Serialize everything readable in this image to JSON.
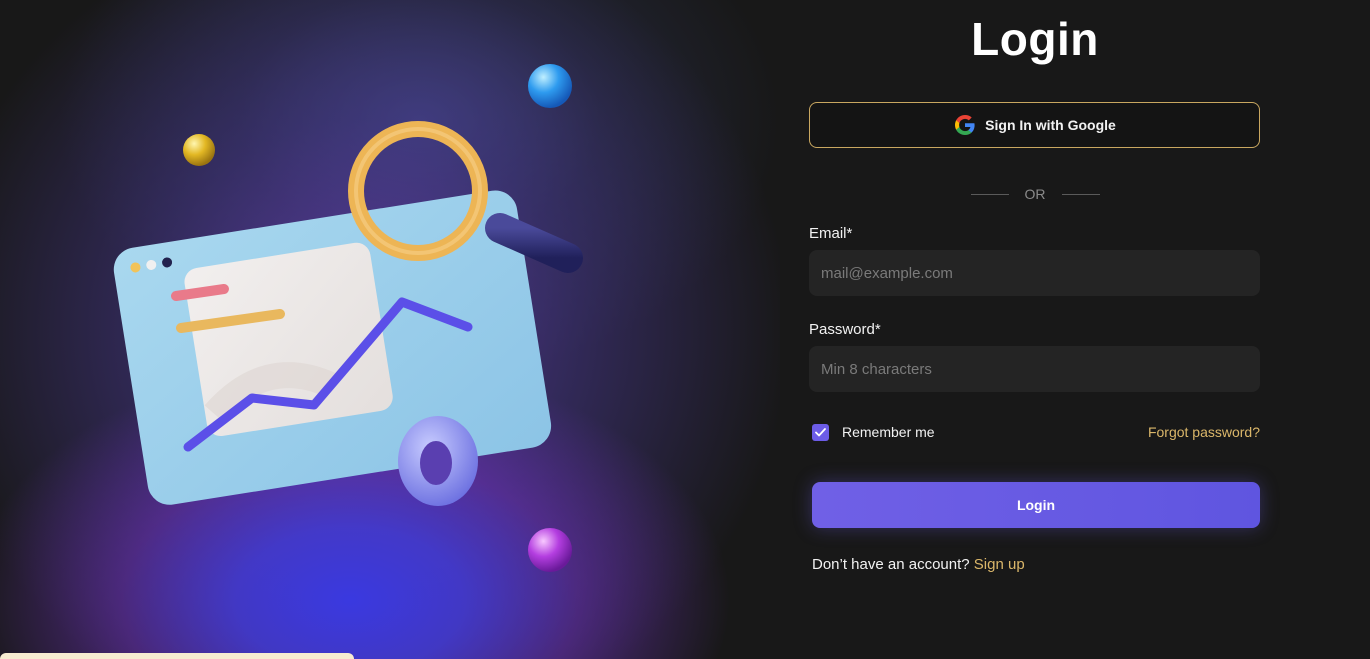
{
  "login": {
    "title": "Login",
    "google_button": {
      "label": "Sign In with Google",
      "icon": "google-icon"
    },
    "separator_text": "OR",
    "email": {
      "label": "Email*",
      "placeholder": "mail@example.com",
      "value": ""
    },
    "password": {
      "label": "Password*",
      "placeholder": "Min 8 characters",
      "value": ""
    },
    "remember": {
      "label": "Remember me",
      "checked": true
    },
    "forgot_link": "Forgot password?",
    "submit_label": "Login",
    "signup": {
      "prompt": "Don’t have an account?",
      "link": "Sign up"
    }
  },
  "illustration": {
    "icon": "analytics-search-illustration"
  },
  "colors": {
    "background": "#181818",
    "accent": "#6c5ce7",
    "gold": "#dbb76a",
    "input_bg": "#242424"
  }
}
